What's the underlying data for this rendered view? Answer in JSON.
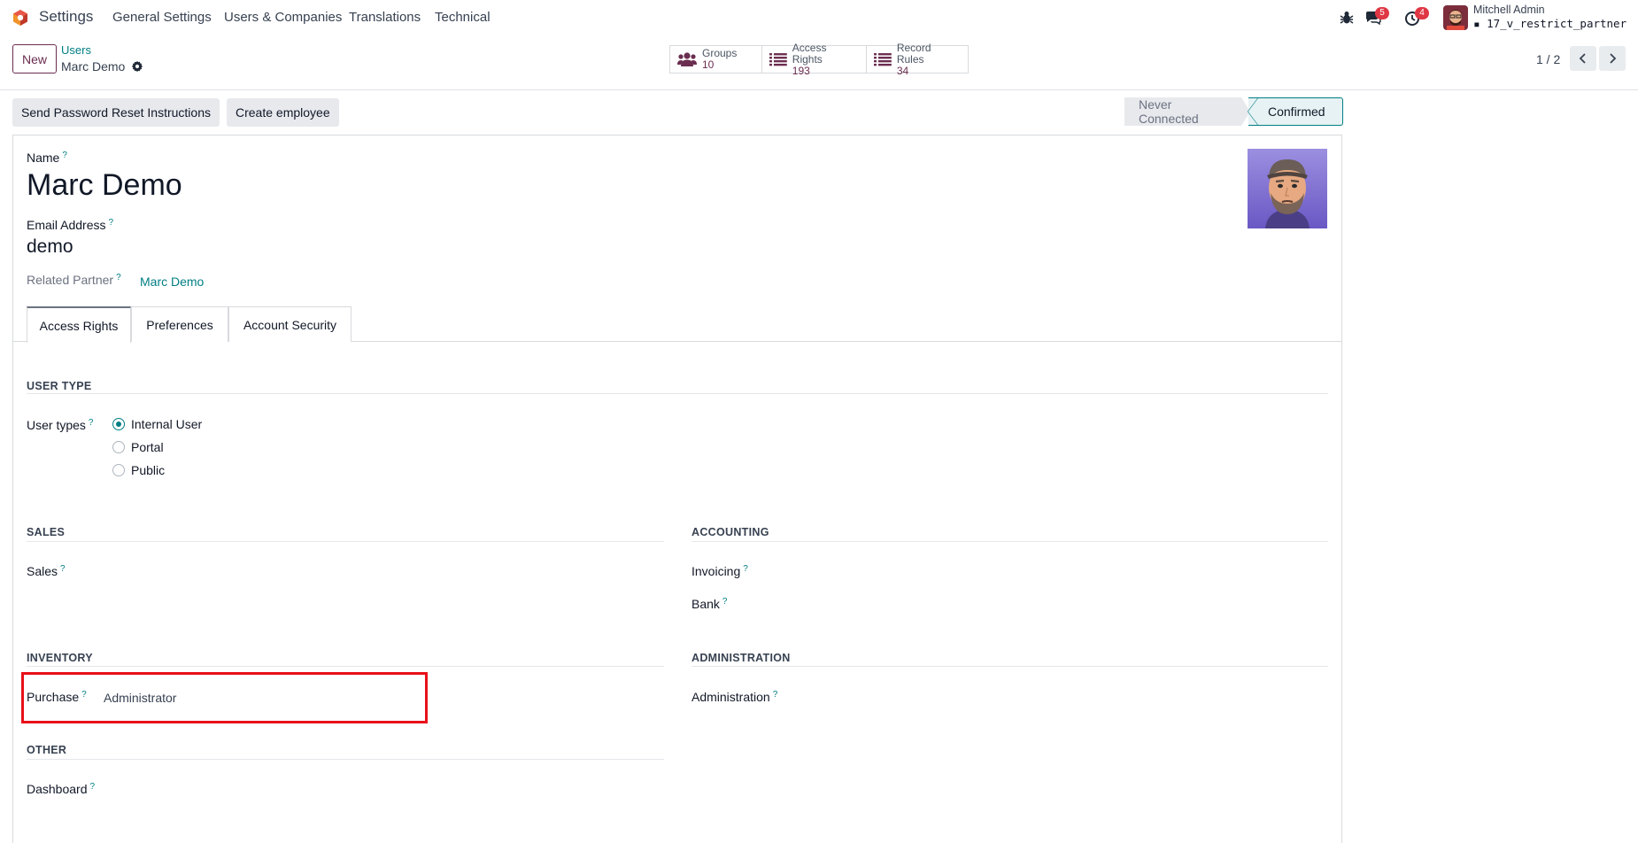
{
  "navbar": {
    "app_name": "Settings",
    "menu": [
      "General Settings",
      "Users & Companies",
      "Translations",
      "Technical"
    ],
    "messages_count": "5",
    "activities_count": "4",
    "user_name": "Mitchell Admin",
    "database": "17_v_restrict_partner",
    "brand_color": "#6b2d4f"
  },
  "control_panel": {
    "new_label": "New",
    "breadcrumb_parent": "Users",
    "breadcrumb_current": "Marc Demo",
    "smart_buttons": [
      {
        "label": "Groups",
        "value": "10",
        "icon": "users-icon"
      },
      {
        "label": "Access Rights",
        "value": "193",
        "icon": "list-icon"
      },
      {
        "label": "Record Rules",
        "value": "34",
        "icon": "list-icon"
      }
    ],
    "pager": "1 / 2"
  },
  "status_bar": {
    "actions": [
      "Send Password Reset Instructions",
      "Create employee"
    ],
    "stages": [
      "Never Connected",
      "Confirmed"
    ],
    "active_stage": "Confirmed"
  },
  "form": {
    "name_label": "Name",
    "name_value": "Marc Demo",
    "email_label": "Email Address",
    "email_value": "demo",
    "partner_label": "Related Partner",
    "partner_value": "Marc Demo",
    "help_mark": "?",
    "tabs": [
      "Access Rights",
      "Preferences",
      "Account Security"
    ],
    "active_tab": "Access Rights"
  },
  "access_rights": {
    "user_type_title": "USER TYPE",
    "user_types_label": "User types",
    "user_types": [
      "Internal User",
      "Portal",
      "Public"
    ],
    "selected_user_type": "Internal User",
    "sales_title": "SALES",
    "sales_label": "Sales",
    "accounting_title": "ACCOUNTING",
    "invoicing_label": "Invoicing",
    "bank_label": "Bank",
    "inventory_title": "INVENTORY",
    "purchase_label": "Purchase",
    "purchase_value": "Administrator",
    "administration_title": "ADMINISTRATION",
    "administration_label": "Administration",
    "other_title": "OTHER",
    "dashboard_label": "Dashboard"
  },
  "colors": {
    "accent": "#017e84",
    "highlight": "#e8101a"
  }
}
